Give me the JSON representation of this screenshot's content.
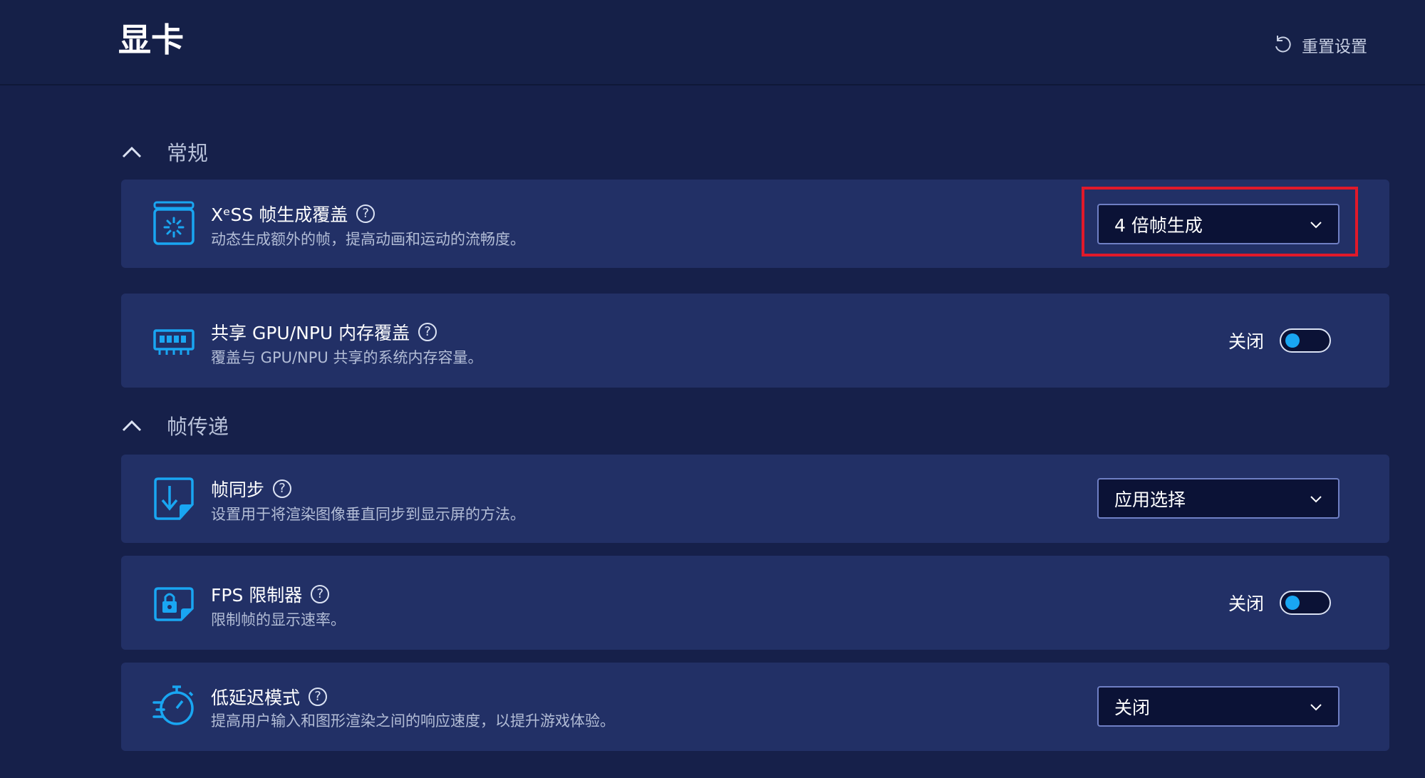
{
  "header": {
    "title": "显卡",
    "reset_label": "重置设置",
    "reset_icon": "reset-icon"
  },
  "sections": [
    {
      "label": "常规",
      "icon": "chevron-up-icon"
    },
    {
      "label": "帧传递",
      "icon": "chevron-up-icon"
    }
  ],
  "settings": {
    "xess": {
      "title": "XᵉSS 帧生成覆盖",
      "desc": "动态生成额外的帧，提高动画和运动的流畅度。",
      "value": "4 倍帧生成",
      "icon": "frame-generation-icon"
    },
    "shared_memory": {
      "title": "共享 GPU/NPU 内存覆盖",
      "desc": "覆盖与 GPU/NPU 共享的系统内存容量。",
      "state_label": "关闭",
      "icon": "memory-chip-icon"
    },
    "frame_sync": {
      "title": "帧同步",
      "desc": "设置用于将渲染图像垂直同步到显示屏的方法。",
      "value": "应用选择",
      "icon": "frame-sync-icon"
    },
    "fps_limiter": {
      "title": "FPS 限制器",
      "desc": "限制帧的显示速率。",
      "state_label": "关闭",
      "icon": "lock-frame-icon"
    },
    "low_latency": {
      "title": "低延迟模式",
      "desc": "提高用户输入和图形渲染之间的响应速度，以提升游戏体验。",
      "value": "关闭",
      "icon": "stopwatch-icon"
    }
  },
  "help_glyph": "?",
  "colors": {
    "background": "#16204a",
    "card": "#223066",
    "accent": "#19a6f2",
    "highlight": "#e0192a"
  }
}
